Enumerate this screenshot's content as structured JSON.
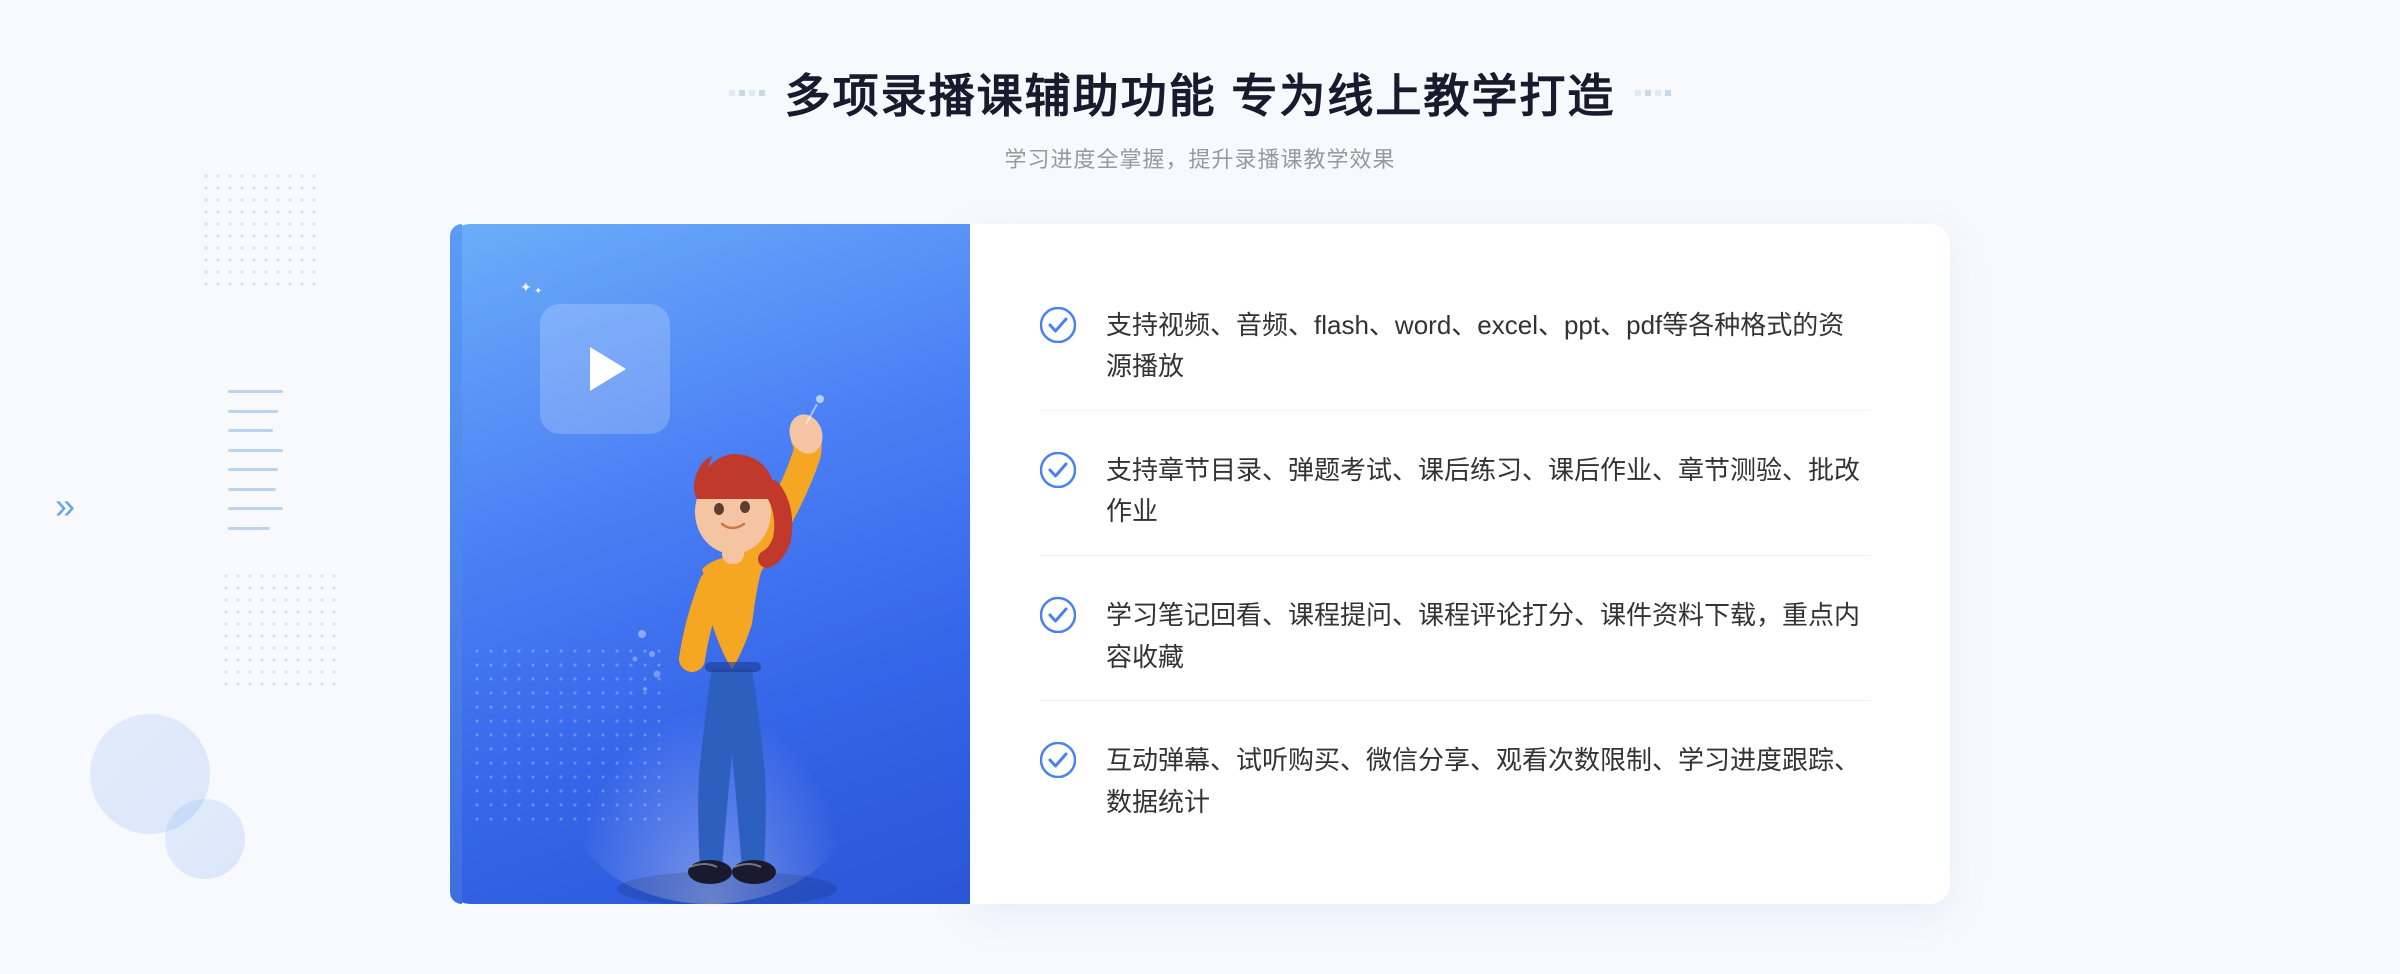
{
  "page": {
    "background_color": "#f0f4fb"
  },
  "header": {
    "title": "多项录播课辅助功能 专为线上教学打造",
    "subtitle": "学习进度全掌握，提升录播课教学效果",
    "title_deco_left": "❖",
    "title_deco_right": "❖"
  },
  "features": [
    {
      "id": 1,
      "text": "支持视频、音频、flash、word、excel、ppt、pdf等各种格式的资源播放"
    },
    {
      "id": 2,
      "text": "支持章节目录、弹题考试、课后练习、课后作业、章节测验、批改作业"
    },
    {
      "id": 3,
      "text": "学习笔记回看、课程提问、课程评论打分、课件资料下载，重点内容收藏"
    },
    {
      "id": 4,
      "text": "互动弹幕、试听购买、微信分享、观看次数限制、学习进度跟踪、数据统计"
    }
  ],
  "colors": {
    "primary_blue": "#4a80f5",
    "dark_blue": "#2a55d6",
    "light_blue": "#6baef8",
    "check_blue": "#4a80f5",
    "text_dark": "#333333",
    "text_light": "#999999"
  },
  "icons": {
    "play": "▶",
    "chevron_right": "»",
    "check": "check-circle"
  }
}
